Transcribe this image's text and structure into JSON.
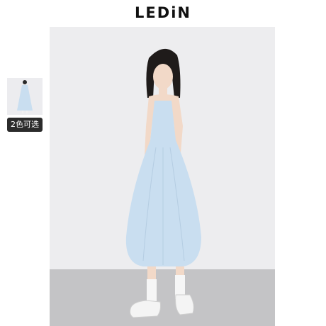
{
  "brand": {
    "name": "LEDiN"
  },
  "gallery": {
    "swatch_label": "2色可选",
    "main_image": "model-in-light-blue-sleeveless-midi-dress",
    "thumbnail_image": "light-blue-dress-thumbnail"
  },
  "colors": {
    "dress": "#c9def0",
    "backdrop": "#ededef",
    "floor": "#c4c4c6",
    "badge": "#2b2b2b"
  }
}
